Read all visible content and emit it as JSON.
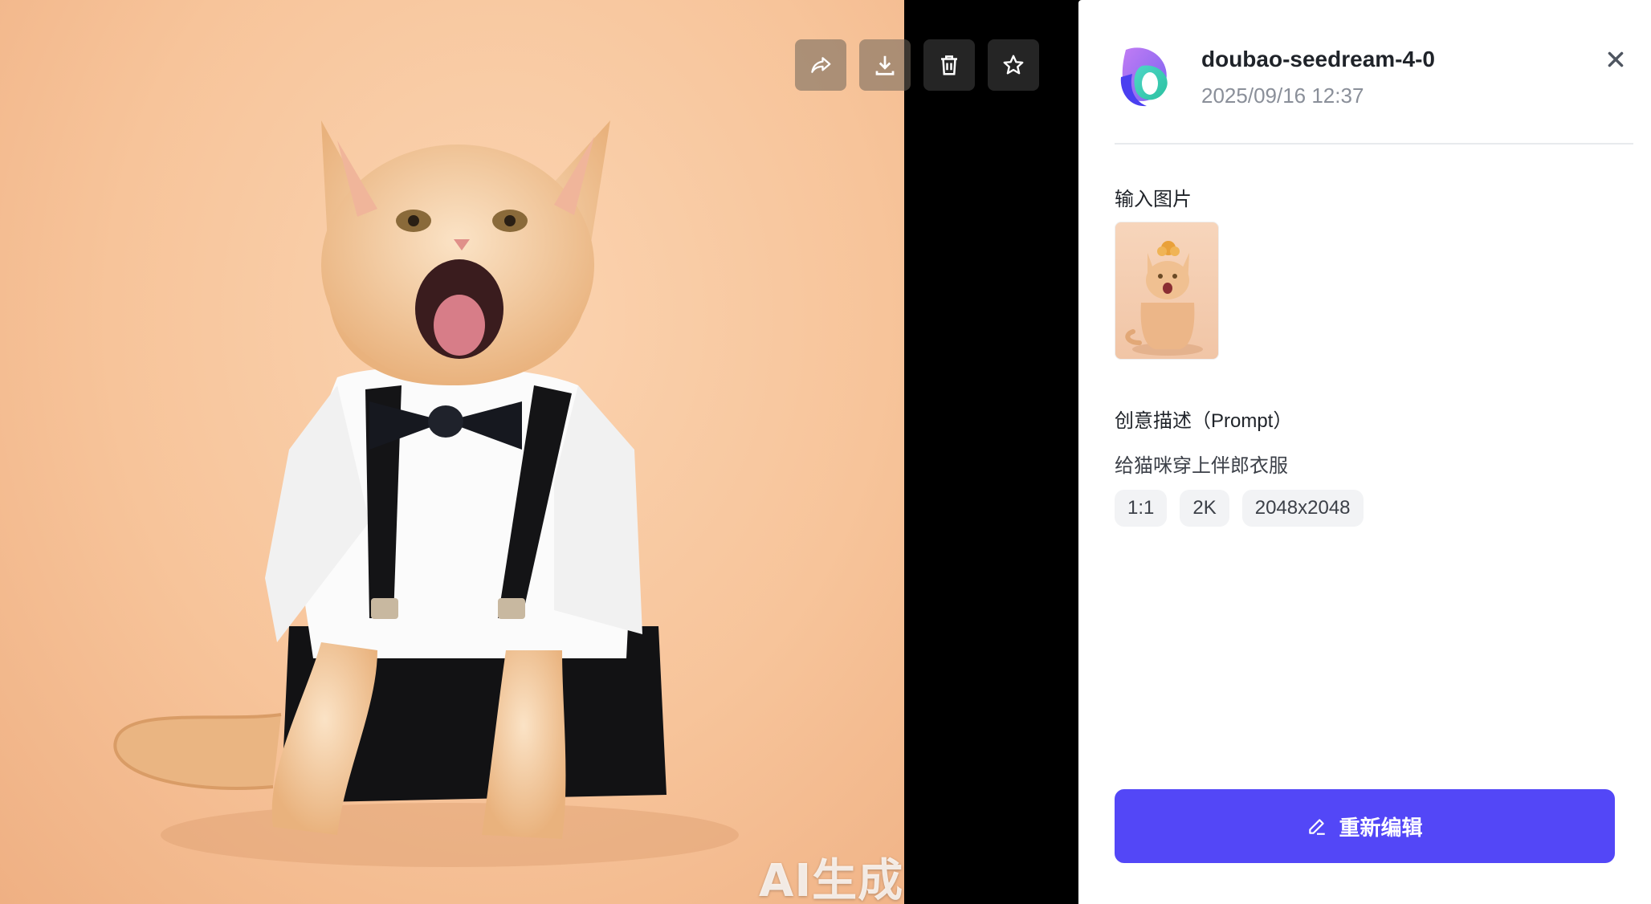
{
  "viewer": {
    "watermark": "AI生成",
    "toolbar": [
      {
        "name": "share-icon"
      },
      {
        "name": "download-icon"
      },
      {
        "name": "trash-icon"
      },
      {
        "name": "star-icon"
      }
    ]
  },
  "detail": {
    "model_name": "doubao-seedream-4-0",
    "timestamp": "2025/09/16 12:37",
    "input_images_label": "输入图片",
    "prompt_label": "创意描述（Prompt）",
    "prompt_text": "给猫咪穿上伴郎衣服",
    "tags": [
      "1:1",
      "2K",
      "2048x2048"
    ],
    "reedit_label": "重新编辑"
  },
  "colors": {
    "accent": "#5347f7",
    "tag_bg": "#f2f3f5",
    "divider": "#e8eaed"
  }
}
